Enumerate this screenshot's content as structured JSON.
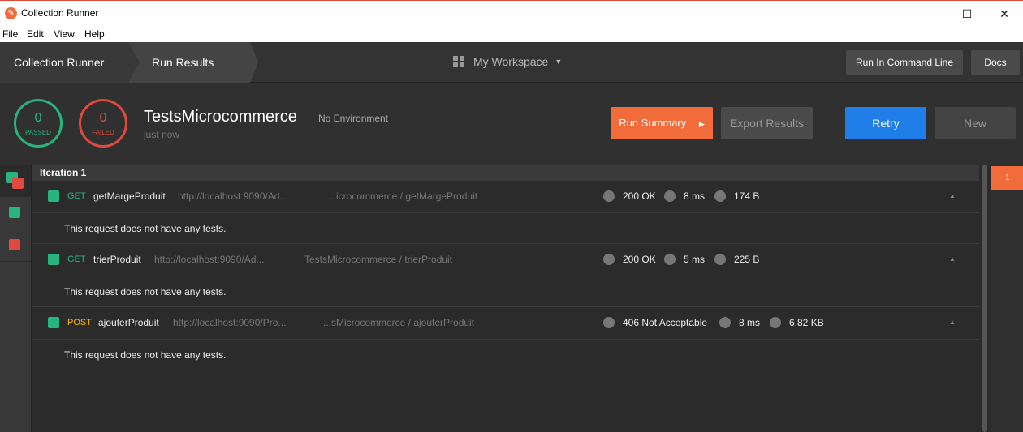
{
  "window": {
    "title": "Collection Runner",
    "minimize": "—",
    "maximize": "☐",
    "close": "✕"
  },
  "menu": [
    "File",
    "Edit",
    "View",
    "Help"
  ],
  "header": {
    "breadcrumb_runner": "Collection Runner",
    "breadcrumb_results": "Run Results",
    "workspace": "My Workspace",
    "cmd_line": "Run In Command Line",
    "docs": "Docs"
  },
  "summary": {
    "passed_count": "0",
    "passed_label": "PASSED",
    "failed_count": "0",
    "failed_label": "FAILED",
    "collection": "TestsMicrocommerce",
    "environment": "No Environment",
    "time": "just now",
    "run_summary": "Run Summary",
    "export": "Export Results",
    "retry": "Retry",
    "new": "New"
  },
  "iteration": {
    "label": "Iteration 1",
    "number": "1"
  },
  "requests": [
    {
      "method": "GET",
      "name": "getMargeProduit",
      "url": "http://localhost:9090/Ad...",
      "path": "...icrocommerce / getMargeProduit",
      "status": "200 OK",
      "time": "8 ms",
      "size": "174 B",
      "note": "This request does not have any tests."
    },
    {
      "method": "GET",
      "name": "trierProduit",
      "url": "http://localhost:9090/Ad...",
      "path": "TestsMicrocommerce / trierProduit",
      "status": "200 OK",
      "time": "5 ms",
      "size": "225 B",
      "note": "This request does not have any tests."
    },
    {
      "method": "POST",
      "name": "ajouterProduit",
      "url": "http://localhost:9090/Pro...",
      "path": "...sMicrocommerce / ajouterProduit",
      "status": "406 Not Acceptable",
      "time": "8 ms",
      "size": "6.82 KB",
      "note": "This request does not have any tests."
    }
  ],
  "colors": {
    "passed": "#26b47f",
    "failed": "#e0493d",
    "accent": "#f26b3a",
    "retry": "#1f7ee8",
    "get": "#26b47f",
    "post": "#ffb400"
  }
}
